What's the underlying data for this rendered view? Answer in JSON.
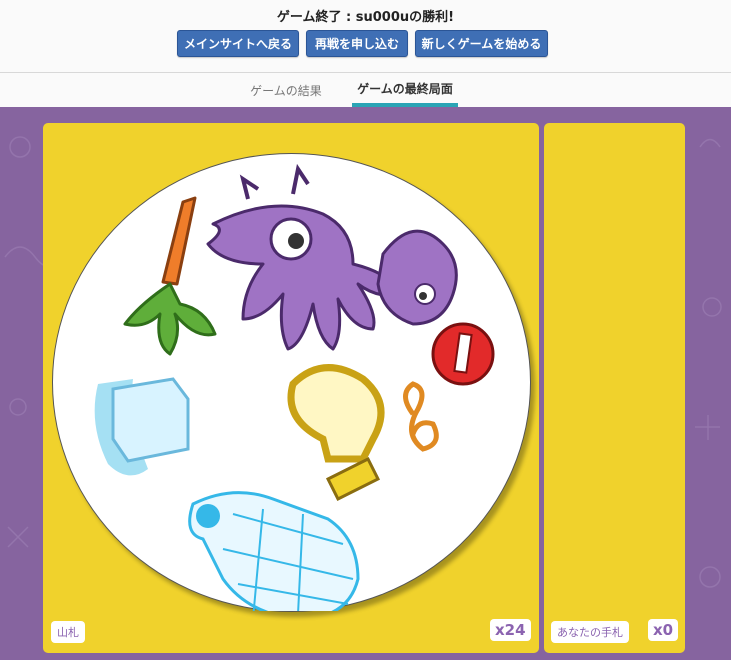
{
  "header": {
    "title": "ゲーム終了 : su000uの勝利!",
    "buttons": {
      "main_site": "メインサイトへ戻る",
      "rematch": "再戦を申し込む",
      "new_game": "新しくゲームを始める"
    }
  },
  "tabs": {
    "results": "ゲームの結果",
    "final_state": "ゲームの最終局面",
    "active": "final_state"
  },
  "pile": {
    "label": "山札",
    "count": "x24",
    "card_symbols": [
      "carrot-icon",
      "purple-hand-monster-icon",
      "purple-bird-icon",
      "no-entry-sign-icon",
      "treble-clef-icon",
      "lightbulb-icon",
      "ice-cube-icon",
      "glass-bottle-icon"
    ]
  },
  "hand": {
    "label": "あなたの手札",
    "count": "x0"
  },
  "colors": {
    "board_bg": "#86649f",
    "panel": "#f0d22c",
    "button": "#3f6fb5",
    "tab_accent": "#2aa4b5",
    "badge_text": "#8b63b0"
  }
}
